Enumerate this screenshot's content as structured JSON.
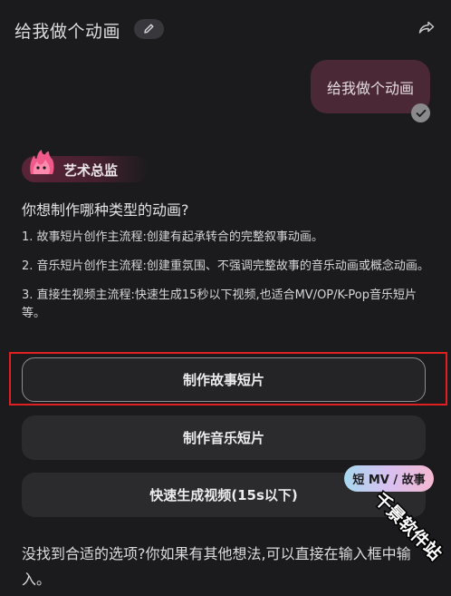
{
  "header": {
    "title": "给我做个动画",
    "edit_icon": "pencil-icon",
    "share_icon": "share-icon"
  },
  "user_message": {
    "text": "给我做个动画",
    "status_icon": "check-icon"
  },
  "agent": {
    "name": "艺术总监",
    "avatar_icon": "flame-mascot-icon"
  },
  "reply": {
    "question": "你想制作哪种类型的动画?",
    "items": [
      "1. 故事短片创作主流程:创建有起承转合的完整叙事动画。",
      "2. 音乐短片创作主流程:创建重氛围、不强调完整故事的音乐动画或概念动画。",
      "3. 直接生视频主流程:快速生成15秒以下视频,也适合MV/OP/K-Pop音乐短片等。"
    ]
  },
  "options": [
    {
      "label": "制作故事短片",
      "selected": true
    },
    {
      "label": "制作音乐短片",
      "selected": false
    },
    {
      "label": "快速生成视频(15s以下)",
      "selected": false
    }
  ],
  "badge": {
    "text": "短 MV / 故事"
  },
  "footer": {
    "text": "没找到合适的选项?你如果有其他想法,可以直接在输入框中输入。"
  },
  "watermark": {
    "text": "千景软件站"
  },
  "colors": {
    "background": "#1b1b1d",
    "user_bubble": "#4a2836",
    "option_bg": "#2b2b2e",
    "highlight_frame": "#e02020"
  }
}
